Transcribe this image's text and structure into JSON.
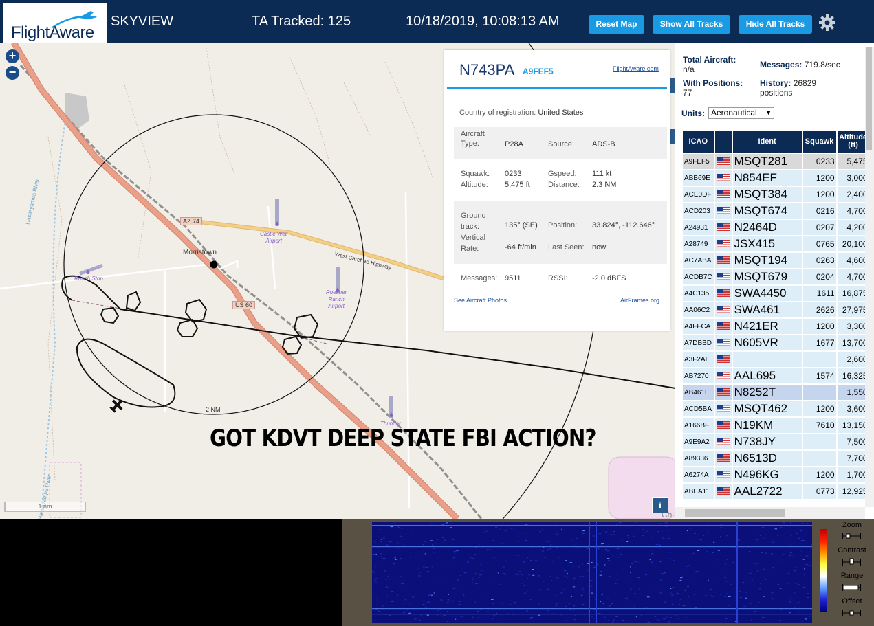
{
  "header": {
    "logo": "FlightAware",
    "app_name": "SKYVIEW",
    "tracked": "TA Tracked: 125",
    "datetime": "10/18/2019, 10:08:13 AM",
    "buttons": {
      "reset": "Reset Map",
      "show_all": "Show All Tracks",
      "hide_all": "Hide All Tracks"
    }
  },
  "map": {
    "zoom_in": "+",
    "zoom_out": "−",
    "scale": "1 nm",
    "ring_label": "2 NM",
    "labels": {
      "town": "Morristown",
      "highway1": "AZ 74",
      "highway2": "US 60",
      "road": "West Carefree Highway",
      "river": "Hassayampa River",
      "river2": "Hassayampa River",
      "partial": "Ch"
    },
    "airports": {
      "castle_well": "Castle Well\nAirport",
      "ranch_strip": "Ranch Strip",
      "roesner": "Roesner\nRanch\nAirport",
      "thunder": "Thunder"
    },
    "overlay_text": "GOT KDVT DEEP STATE FBI ACTION?",
    "info_button": "i"
  },
  "aircraft_panel": {
    "ident": "N743PA",
    "hex": "A9FEF5",
    "flightaware_link": "FlightAware.com",
    "country_label": "Country of registration:",
    "country": "United States",
    "type_label": "Aircraft\nType:",
    "type": "P28A",
    "source_label": "Source:",
    "source": "ADS-B",
    "squawk_label": "Squawk:",
    "squawk": "0233",
    "gspeed_label": "Gspeed:",
    "gspeed": "111 kt",
    "altitude_label": "Altitude:",
    "altitude": "5,475 ft",
    "distance_label": "Distance:",
    "distance": "2.3 NM",
    "track_label": "Ground\ntrack:",
    "track": "135° (SE)",
    "position_label": "Position:",
    "position": "33.824°, -112.646°",
    "vrate_label": "Vertical\nRate:",
    "vrate": "-64 ft/min",
    "lastseen_label": "Last Seen:",
    "lastseen": "now",
    "messages_label": "Messages:",
    "messages": "9511",
    "rssi_label": "RSSI:",
    "rssi": "-2.0 dBFS",
    "photos_link": "See Aircraft Photos",
    "airframes_link": "AirFrames.org"
  },
  "sidebar": {
    "total_label": "Total Aircraft:",
    "total": "n/a",
    "messages_label": "Messages:",
    "messages": "719.8/sec",
    "positions_label": "With Positions:",
    "positions": "77",
    "history_label": "History:",
    "history": "26829",
    "history_unit": "positions",
    "units_label": "Units:",
    "units_value": "Aeronautical",
    "columns": [
      "ICAO",
      "",
      "Ident",
      "Squawk",
      "Altitude\n(ft)"
    ],
    "rows": [
      {
        "icao": "A9FEF5",
        "ident": "MSQT281",
        "squawk": "0233",
        "alt": "5,475"
      },
      {
        "icao": "ABB69E",
        "ident": "N854EF",
        "squawk": "1200",
        "alt": "3,000"
      },
      {
        "icao": "ACE0DF",
        "ident": "MSQT384",
        "squawk": "1200",
        "alt": "2,400"
      },
      {
        "icao": "ACD203",
        "ident": "MSQT674",
        "squawk": "0216",
        "alt": "4,700"
      },
      {
        "icao": "A24931",
        "ident": "N2464D",
        "squawk": "0207",
        "alt": "4,200"
      },
      {
        "icao": "A28749",
        "ident": "JSX415",
        "squawk": "0765",
        "alt": "20,100"
      },
      {
        "icao": "AC7ABA",
        "ident": "MSQT194",
        "squawk": "0263",
        "alt": "4,600"
      },
      {
        "icao": "ACDB7C",
        "ident": "MSQT679",
        "squawk": "0204",
        "alt": "4,700"
      },
      {
        "icao": "A4C135",
        "ident": "SWA4450",
        "squawk": "1611",
        "alt": "16,875"
      },
      {
        "icao": "AA06C2",
        "ident": "SWA461",
        "squawk": "2626",
        "alt": "27,975"
      },
      {
        "icao": "A4FFCA",
        "ident": "N421ER",
        "squawk": "1200",
        "alt": "3,300"
      },
      {
        "icao": "A7DBBD",
        "ident": "N605VR",
        "squawk": "1677",
        "alt": "13,700"
      },
      {
        "icao": "A3F2AE",
        "ident": "",
        "squawk": "",
        "alt": "2,600"
      },
      {
        "icao": "AB7270",
        "ident": "AAL695",
        "squawk": "1574",
        "alt": "16,325"
      },
      {
        "icao": "AB461E",
        "ident": "N8252T",
        "squawk": "",
        "alt": "1,550"
      },
      {
        "icao": "ACD5BA",
        "ident": "MSQT462",
        "squawk": "1200",
        "alt": "3,600"
      },
      {
        "icao": "A166BF",
        "ident": "N19KM",
        "squawk": "7610",
        "alt": "13,150"
      },
      {
        "icao": "A9E9A2",
        "ident": "N738JY",
        "squawk": "",
        "alt": "7,500"
      },
      {
        "icao": "A89336",
        "ident": "N6513D",
        "squawk": "",
        "alt": "7,700"
      },
      {
        "icao": "A6274A",
        "ident": "N496KG",
        "squawk": "1200",
        "alt": "1,700"
      },
      {
        "icao": "ABEA11",
        "ident": "AAL2722",
        "squawk": "0773",
        "alt": "12,925"
      }
    ]
  },
  "waterfall_controls": {
    "zoom": "Zoom",
    "contrast": "Contrast",
    "range": "Range",
    "offset": "Offset"
  },
  "colors": {
    "header_bg": "#0b2a54",
    "button_blue": "#1a9ae2",
    "highway": "#e8a088",
    "road_yellow": "#f3cf8a"
  }
}
